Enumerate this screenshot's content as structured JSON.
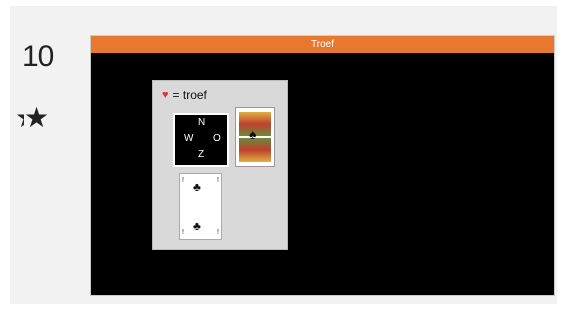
{
  "rank": "10",
  "rating": {
    "stars_shown": 1.3
  },
  "window": {
    "title": "Troef"
  },
  "game": {
    "trump_suit": "♥",
    "trump_label": "= troef",
    "compass": {
      "north": "N",
      "west": "W",
      "east": "O",
      "south": "Z"
    },
    "face_card_suit": "♠",
    "club_card": {
      "suit": "♣",
      "corner": "!"
    }
  }
}
